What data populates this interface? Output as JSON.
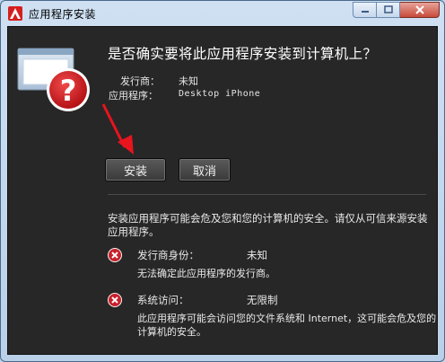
{
  "window": {
    "title": "应用程序安装"
  },
  "dialog": {
    "question": "是否确实要将此应用程序安装到计算机上？",
    "publisher_label": "发行商：",
    "publisher_value": "未知",
    "application_label": "应用程序：",
    "application_value": "Desktop iPhone",
    "install_label": "安装",
    "cancel_label": "取消",
    "warning_text": "安装应用程序可能会危及您和您的计算机的安全。请仅从可信来源安装应用程序。",
    "risks": [
      {
        "label": "发行商身份：",
        "value": "未知",
        "description": "无法确定此应用程序的发行商。"
      },
      {
        "label": "系统访问：",
        "value": "无限制",
        "description": "此应用程序可能会访问您的文件系统和 Internet，这可能会危及您的计算机的安全。"
      }
    ]
  },
  "colors": {
    "client_background": "#272727",
    "error_red": "#c8202b",
    "arrow_red": "#e8141e"
  },
  "icons": {
    "logo": "adobe-air-logo-icon",
    "big": "question-mark-window-icon",
    "risk": "error-x-icon"
  }
}
